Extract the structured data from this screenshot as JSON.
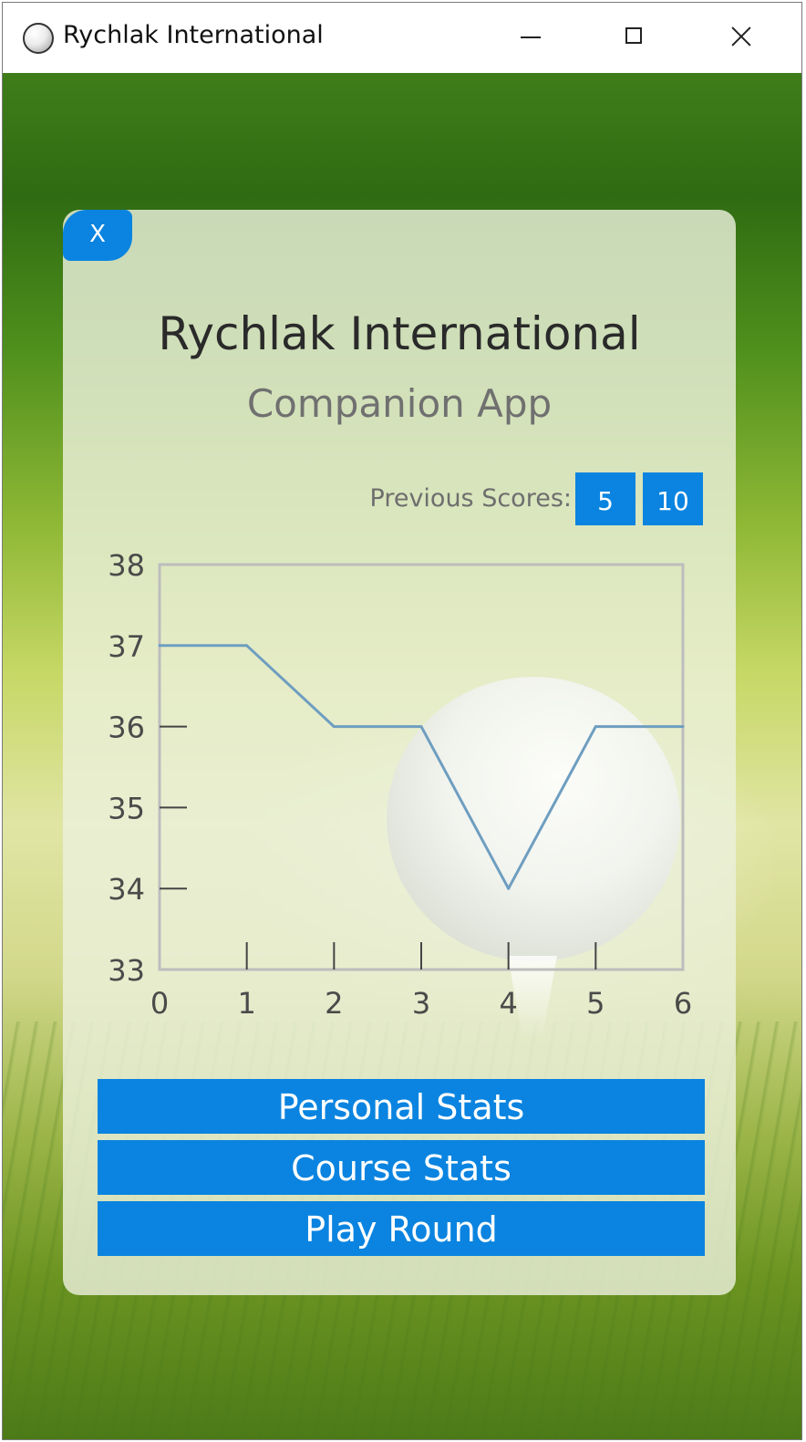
{
  "window": {
    "title": "Rychlak International",
    "icon": "golf-ball-icon",
    "controls": [
      "minimize-icon",
      "maximize-icon",
      "close-icon"
    ]
  },
  "panel": {
    "close_label": "X",
    "title": "Rychlak International",
    "subtitle": "Companion App",
    "previous_scores_label": "Previous Scores:",
    "score_buttons": [
      "5",
      "10"
    ]
  },
  "buttons": {
    "personal_stats": "Personal Stats",
    "course_stats": "Course Stats",
    "play_round": "Play Round"
  },
  "colors": {
    "accent": "#0A84E0",
    "line": "#6E9EC0",
    "axis": "#BDBDBD"
  },
  "chart_data": {
    "type": "line",
    "x": [
      0,
      1,
      2,
      3,
      4,
      5,
      6
    ],
    "series": [
      {
        "values": [
          37,
          37,
          36,
          36,
          34,
          36,
          36
        ]
      }
    ],
    "xlim": [
      0,
      6
    ],
    "ylim": [
      33,
      38
    ],
    "xticks": [
      "0",
      "1",
      "2",
      "3",
      "4",
      "5",
      "6"
    ],
    "yticks": [
      "33",
      "34",
      "35",
      "36",
      "37",
      "38"
    ],
    "title": "",
    "xlabel": "",
    "ylabel": "",
    "grid": false
  }
}
